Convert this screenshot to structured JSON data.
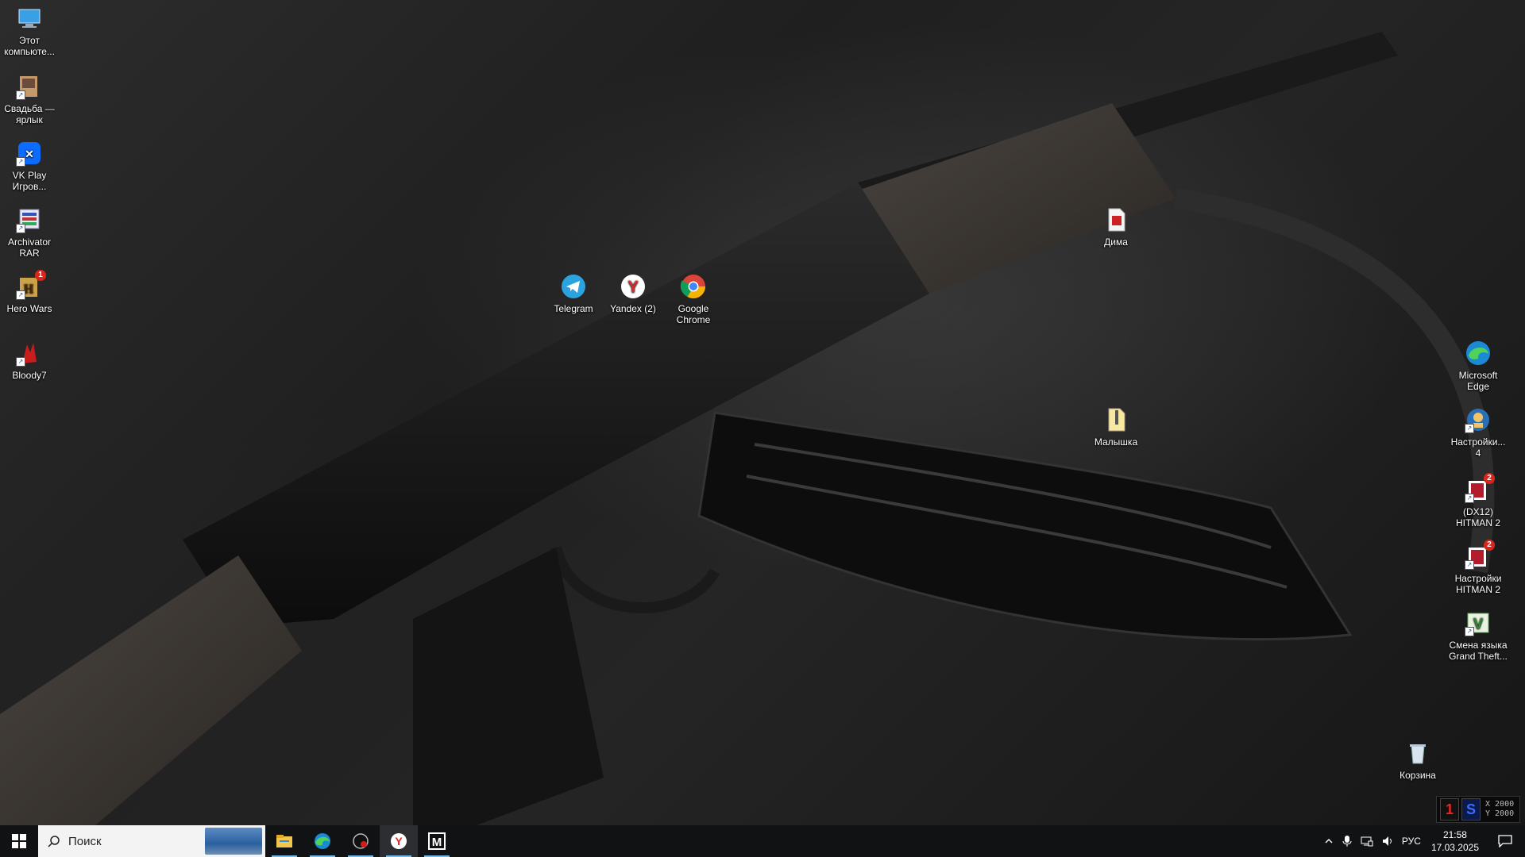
{
  "desktop": {
    "left_icons": [
      {
        "label": "Этот компьюте...",
        "icon": "this-pc-icon"
      },
      {
        "label": "Свадьба — ярлык",
        "icon": "folder-shortcut-icon"
      },
      {
        "label": "VK Play Игров...",
        "icon": "vk-play-icon"
      },
      {
        "label": "Archivator RAR",
        "icon": "winrar-icon"
      },
      {
        "label": "Hero Wars",
        "icon": "hero-wars-icon",
        "badge": "1"
      },
      {
        "label": "Bloody7",
        "icon": "bloody7-icon"
      }
    ],
    "middle_icons": [
      {
        "label": "Telegram",
        "icon": "telegram-icon"
      },
      {
        "label": "Yandex (2)",
        "icon": "yandex-browser-icon"
      },
      {
        "label": "Google Chrome",
        "icon": "chrome-icon"
      }
    ],
    "file_icons": [
      {
        "label": "Дима",
        "icon": "pdf-document-icon"
      },
      {
        "label": "Малышка",
        "icon": "zip-archive-icon"
      }
    ],
    "right_icons": [
      {
        "label": "Microsoft Edge",
        "icon": "edge-icon"
      },
      {
        "label": "Настройки... 4",
        "icon": "fallout-settings-icon"
      },
      {
        "label": "(DX12) HITMAN 2",
        "icon": "hitman2-icon",
        "badge": "2"
      },
      {
        "label": "Настройки HITMAN 2",
        "icon": "hitman2-settings-icon",
        "badge": "2"
      },
      {
        "label": "Смена языка Grand Theft...",
        "icon": "gta-language-icon"
      }
    ],
    "recycle_bin": {
      "label": "Корзина",
      "icon": "recycle-bin-icon"
    }
  },
  "widget": {
    "line1": "X 2000",
    "line2": "Y 2000",
    "left_mark": "1",
    "right_mark": "S"
  },
  "taskbar": {
    "search_placeholder": "Поиск",
    "apps": [
      {
        "name": "file-explorer",
        "icon": "file-explorer-icon"
      },
      {
        "name": "edge",
        "icon": "edge-icon"
      },
      {
        "name": "bloody",
        "icon": "bloody-app-icon"
      },
      {
        "name": "yandex",
        "icon": "yandex-browser-icon",
        "active": true
      },
      {
        "name": "m-app",
        "icon": "m-app-icon"
      }
    ],
    "tray": {
      "language": "РУС",
      "time": "21:58",
      "date": "17.03.2025"
    }
  },
  "colors": {
    "taskbar_bg": "#101214",
    "running_indicator": "#76b9ed",
    "search_bg": "#f3f3f3"
  }
}
